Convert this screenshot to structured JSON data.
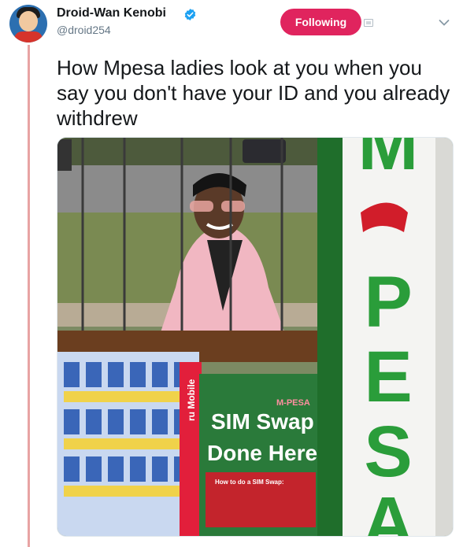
{
  "tweet": {
    "display_name": "Droid-Wan Kenobi",
    "handle": "@droid254",
    "follow_label": "Following",
    "text": "How Mpesa ladies look at you when you say you don't have your ID and you already withdrew"
  },
  "media": {
    "sign_lines": [
      "SIM Swap",
      "Done Here"
    ],
    "small_sign_heading": "How to do a SIM Swap:",
    "sign_brand": "M-PESA",
    "vertical_letters": [
      "M",
      "P",
      "E",
      "S",
      "A"
    ],
    "kiosk_side_text": "ru Mobile"
  },
  "colors": {
    "accent": "#e0245e",
    "verified": "#1da1f2",
    "mpesa_green": "#2a9d3a"
  }
}
